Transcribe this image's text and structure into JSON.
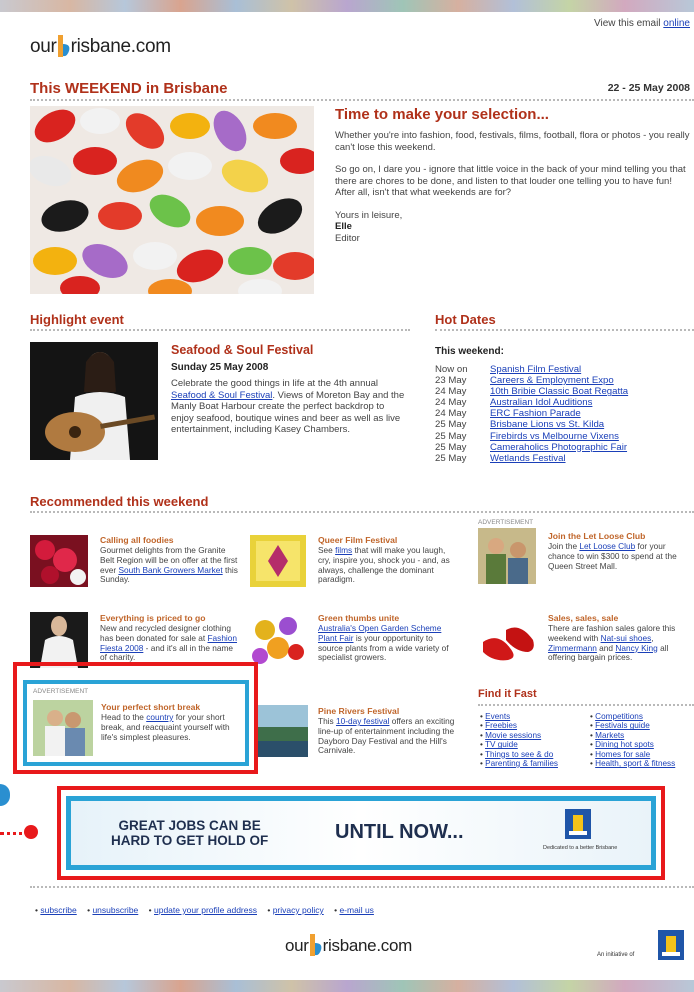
{
  "header": {
    "view_online": "View this email ",
    "online_link": "online",
    "logo_left": "our",
    "logo_right": "risbane.com",
    "title": "This WEEKEND in Brisbane",
    "dates": "22 - 25 May 2008"
  },
  "intro": {
    "heading": "Time to make your selection...",
    "p1": "Whether you're into fashion, food, festivals, films, football, flora or photos - you really can't lose this weekend.",
    "p2": "So go on, I dare you - ignore that little voice in the back of your mind telling you that there are chores to be done, and listen to that louder one telling you to have fun! After all, isn't that what weekends are for?",
    "signoff": "Yours in leisure,",
    "name": "Elle",
    "role": "Editor"
  },
  "highlight": {
    "section_title": "Highlight event",
    "title": "Seafood & Soul Festival",
    "date": "Sunday 25 May 2008",
    "text_a": "Celebrate the good things in life at the 4th annual ",
    "link": "Seafood & Soul Festival",
    "text_b": ". Views of Moreton Bay and the Manly Boat Harbour create the perfect backdrop to enjoy seafood, boutique wines and beer as well as live entertainment, including Kasey Chambers."
  },
  "hot_dates": {
    "section_title": "Hot Dates",
    "subtitle": "This weekend:",
    "items": [
      {
        "date": "Now on",
        "event": "Spanish Film Festival"
      },
      {
        "date": "23 May",
        "event": "Careers & Employment Expo"
      },
      {
        "date": "24 May",
        "event": "10th Bribie Classic Boat Regatta"
      },
      {
        "date": "24 May",
        "event": "Australian Idol Auditions"
      },
      {
        "date": "24 May",
        "event": "ERC Fashion Parade"
      },
      {
        "date": "25 May",
        "event": "Brisbane Lions vs St. Kilda"
      },
      {
        "date": "25 May",
        "event": "Firebirds vs Melbourne Vixens"
      },
      {
        "date": "25 May",
        "event": "Cameraholics Photographic Fair"
      },
      {
        "date": "25 May",
        "event": "Wetlands Festival"
      }
    ]
  },
  "recommended": {
    "section_title": "Recommended this weekend",
    "advert_label": "ADVERTISEMENT",
    "foodies": {
      "title": "Calling all foodies",
      "a": "Gourmet delights from the Granite Belt Region will be on offer at the first ever ",
      "link": "South Bank Growers Market",
      "b": " this Sunday."
    },
    "queer": {
      "title": "Queer Film Festival",
      "a": "See ",
      "link": "films",
      "b": " that will make you laugh, cry, inspire you, shock you - and, as always, challenge the dominant paradigm."
    },
    "loose": {
      "title": "Join the Let Loose Club",
      "a": "Join the ",
      "link": "Let Loose Club",
      "b": " for your chance to win $300 to spend at the Queen Street Mall."
    },
    "priced": {
      "title": "Everything is priced to go",
      "a": "New and recycled designer clothing has been donated for sale at ",
      "link": "Fashion Fiesta 2008",
      "b": " - and it's all in the name of charity."
    },
    "green": {
      "title": "Green thumbs unite",
      "link": "Australia's Open Garden Scheme Plant Fair",
      "b": " is your opportunity to source plants from a wide variety of specialist growers."
    },
    "sales": {
      "title": "Sales, sales, sale",
      "a": "There are fashion sales galore this weekend with ",
      "link1": "Nat-sui shoes",
      "mid": ", ",
      "link2": "Zimmermann",
      "mid2": " and ",
      "link3": "Nancy King",
      "b": " all offering bargain prices."
    },
    "short_break": {
      "title": "Your perfect short break",
      "a": "Head to the ",
      "link": "country",
      "b": " for your short break, and reacquaint yourself with life's simplest pleasures."
    },
    "pine": {
      "title": "Pine Rivers Festival",
      "a": "This ",
      "link": "10-day festival",
      "b": " offers an exciting line-up of entertainment including the Dayboro Day Festival and the Hill's Carnivale."
    }
  },
  "find_it_fast": {
    "title": "Find it Fast",
    "col1": [
      "Events",
      "Freebies",
      "Movie sessions",
      "TV guide",
      "Things to see & do",
      "Parenting & families"
    ],
    "col2": [
      "Competitions",
      "Festivals guide",
      "Markets",
      "Dining hot spots",
      "Homes for sale",
      "Health, sport & fitness"
    ]
  },
  "banner": {
    "line1": "GREAT JOBS CAN BE",
    "line2": "HARD TO GET HOLD OF",
    "cta": "UNTIL NOW...",
    "tagline": "Dedicated to a better Brisbane"
  },
  "footer": {
    "links": [
      "subscribe",
      "unsubscribe",
      "update your profile address",
      "privacy policy",
      "e-mail us"
    ],
    "initiative": "An initiative of"
  },
  "colors": {
    "accent_red": "#b0311a",
    "orange": "#c0652a",
    "link": "#1a3fb8",
    "highlight_box": "#e8191b",
    "ad_frame": "#2aa3d6"
  }
}
